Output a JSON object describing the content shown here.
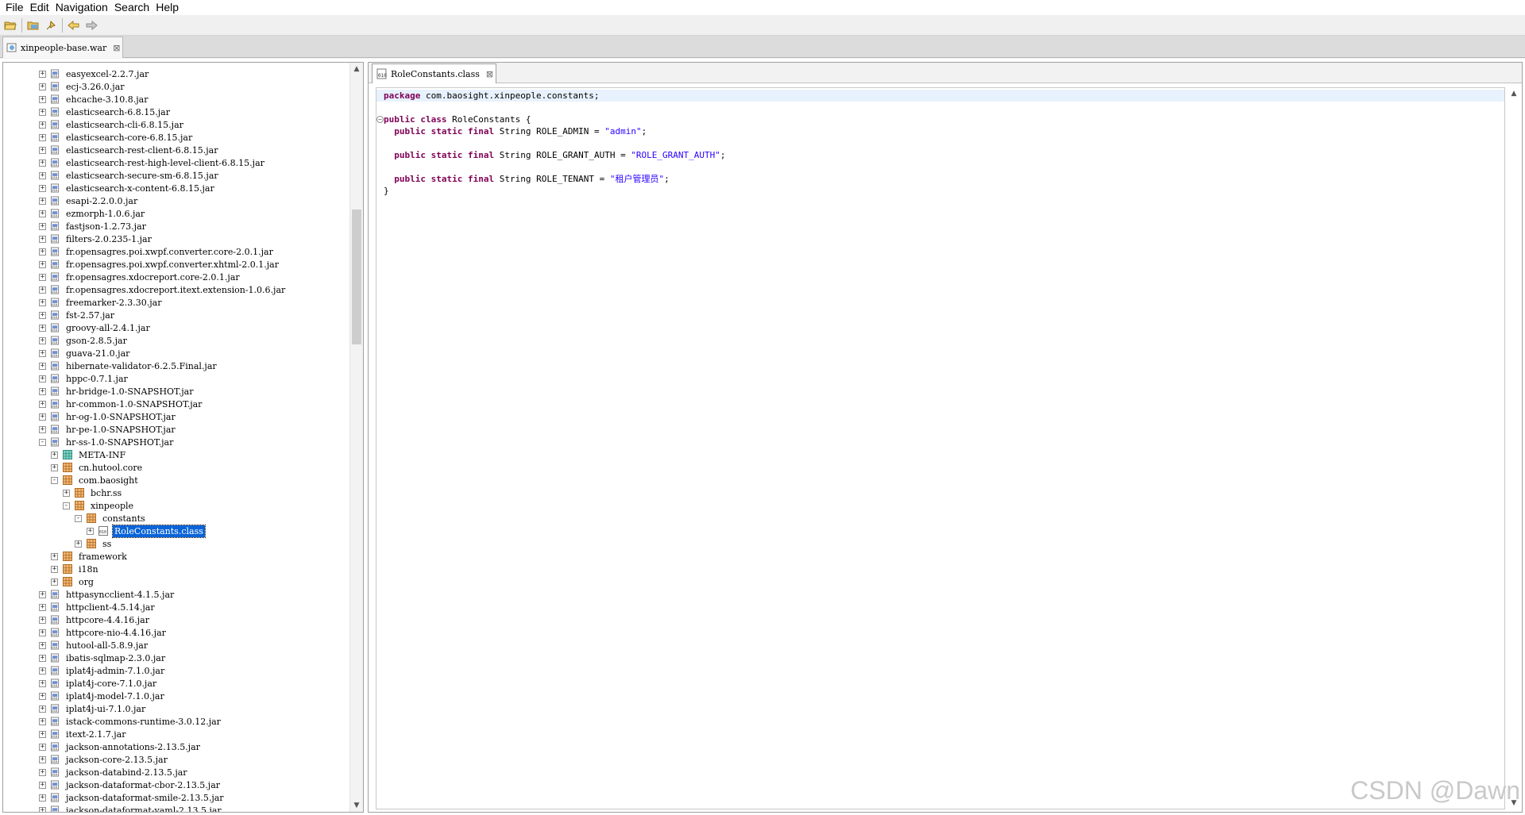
{
  "menu": [
    "File",
    "Edit",
    "Navigation",
    "Search",
    "Help"
  ],
  "toolbar": {
    "icons": [
      "open-file-icon",
      "open-folder-icon",
      "pin-icon",
      "back-arrow-icon",
      "forward-arrow-icon"
    ]
  },
  "outer_tab": {
    "label": "xinpeople-base.war",
    "close": "⊠"
  },
  "editor_tab": {
    "label": "RoleConstants.class",
    "close": "⊠"
  },
  "tree": [
    {
      "label": "easyexcel-2.2.7.jar",
      "level": 0,
      "type": "jar",
      "exp": "+"
    },
    {
      "label": "ecj-3.26.0.jar",
      "level": 0,
      "type": "jar",
      "exp": "+"
    },
    {
      "label": "ehcache-3.10.8.jar",
      "level": 0,
      "type": "jar",
      "exp": "+"
    },
    {
      "label": "elasticsearch-6.8.15.jar",
      "level": 0,
      "type": "jar",
      "exp": "+"
    },
    {
      "label": "elasticsearch-cli-6.8.15.jar",
      "level": 0,
      "type": "jar",
      "exp": "+"
    },
    {
      "label": "elasticsearch-core-6.8.15.jar",
      "level": 0,
      "type": "jar",
      "exp": "+"
    },
    {
      "label": "elasticsearch-rest-client-6.8.15.jar",
      "level": 0,
      "type": "jar",
      "exp": "+"
    },
    {
      "label": "elasticsearch-rest-high-level-client-6.8.15.jar",
      "level": 0,
      "type": "jar",
      "exp": "+"
    },
    {
      "label": "elasticsearch-secure-sm-6.8.15.jar",
      "level": 0,
      "type": "jar",
      "exp": "+"
    },
    {
      "label": "elasticsearch-x-content-6.8.15.jar",
      "level": 0,
      "type": "jar",
      "exp": "+"
    },
    {
      "label": "esapi-2.2.0.0.jar",
      "level": 0,
      "type": "jar",
      "exp": "+"
    },
    {
      "label": "ezmorph-1.0.6.jar",
      "level": 0,
      "type": "jar",
      "exp": "+"
    },
    {
      "label": "fastjson-1.2.73.jar",
      "level": 0,
      "type": "jar",
      "exp": "+"
    },
    {
      "label": "filters-2.0.235-1.jar",
      "level": 0,
      "type": "jar",
      "exp": "+"
    },
    {
      "label": "fr.opensagres.poi.xwpf.converter.core-2.0.1.jar",
      "level": 0,
      "type": "jar",
      "exp": "+"
    },
    {
      "label": "fr.opensagres.poi.xwpf.converter.xhtml-2.0.1.jar",
      "level": 0,
      "type": "jar",
      "exp": "+"
    },
    {
      "label": "fr.opensagres.xdocreport.core-2.0.1.jar",
      "level": 0,
      "type": "jar",
      "exp": "+"
    },
    {
      "label": "fr.opensagres.xdocreport.itext.extension-1.0.6.jar",
      "level": 0,
      "type": "jar",
      "exp": "+"
    },
    {
      "label": "freemarker-2.3.30.jar",
      "level": 0,
      "type": "jar",
      "exp": "+"
    },
    {
      "label": "fst-2.57.jar",
      "level": 0,
      "type": "jar",
      "exp": "+"
    },
    {
      "label": "groovy-all-2.4.1.jar",
      "level": 0,
      "type": "jar",
      "exp": "+"
    },
    {
      "label": "gson-2.8.5.jar",
      "level": 0,
      "type": "jar",
      "exp": "+"
    },
    {
      "label": "guava-21.0.jar",
      "level": 0,
      "type": "jar",
      "exp": "+"
    },
    {
      "label": "hibernate-validator-6.2.5.Final.jar",
      "level": 0,
      "type": "jar",
      "exp": "+"
    },
    {
      "label": "hppc-0.7.1.jar",
      "level": 0,
      "type": "jar",
      "exp": "+"
    },
    {
      "label": "hr-bridge-1.0-SNAPSHOT.jar",
      "level": 0,
      "type": "jar",
      "exp": "+"
    },
    {
      "label": "hr-common-1.0-SNAPSHOT.jar",
      "level": 0,
      "type": "jar",
      "exp": "+"
    },
    {
      "label": "hr-og-1.0-SNAPSHOT.jar",
      "level": 0,
      "type": "jar",
      "exp": "+"
    },
    {
      "label": "hr-pe-1.0-SNAPSHOT.jar",
      "level": 0,
      "type": "jar",
      "exp": "+"
    },
    {
      "label": "hr-ss-1.0-SNAPSHOT.jar",
      "level": 0,
      "type": "jar",
      "exp": "-"
    },
    {
      "label": "META-INF",
      "level": 1,
      "type": "folder",
      "exp": "+"
    },
    {
      "label": "cn.hutool.core",
      "level": 1,
      "type": "pkg",
      "exp": "+"
    },
    {
      "label": "com.baosight",
      "level": 1,
      "type": "pkg",
      "exp": "-"
    },
    {
      "label": "bchr.ss",
      "level": 2,
      "type": "pkg",
      "exp": "+"
    },
    {
      "label": "xinpeople",
      "level": 2,
      "type": "pkg",
      "exp": "-"
    },
    {
      "label": "constants",
      "level": 3,
      "type": "pkg",
      "exp": "-"
    },
    {
      "label": "RoleConstants.class",
      "level": 4,
      "type": "class",
      "exp": "+",
      "selected": true
    },
    {
      "label": "ss",
      "level": 3,
      "type": "pkg",
      "exp": "+"
    },
    {
      "label": "framework",
      "level": 1,
      "type": "pkg",
      "exp": "+"
    },
    {
      "label": "i18n",
      "level": 1,
      "type": "pkg",
      "exp": "+"
    },
    {
      "label": "org",
      "level": 1,
      "type": "pkg",
      "exp": "+"
    },
    {
      "label": "httpasyncclient-4.1.5.jar",
      "level": 0,
      "type": "jar",
      "exp": "+"
    },
    {
      "label": "httpclient-4.5.14.jar",
      "level": 0,
      "type": "jar",
      "exp": "+"
    },
    {
      "label": "httpcore-4.4.16.jar",
      "level": 0,
      "type": "jar",
      "exp": "+"
    },
    {
      "label": "httpcore-nio-4.4.16.jar",
      "level": 0,
      "type": "jar",
      "exp": "+"
    },
    {
      "label": "hutool-all-5.8.9.jar",
      "level": 0,
      "type": "jar",
      "exp": "+"
    },
    {
      "label": "ibatis-sqlmap-2.3.0.jar",
      "level": 0,
      "type": "jar",
      "exp": "+"
    },
    {
      "label": "iplat4j-admin-7.1.0.jar",
      "level": 0,
      "type": "jar",
      "exp": "+"
    },
    {
      "label": "iplat4j-core-7.1.0.jar",
      "level": 0,
      "type": "jar",
      "exp": "+"
    },
    {
      "label": "iplat4j-model-7.1.0.jar",
      "level": 0,
      "type": "jar",
      "exp": "+"
    },
    {
      "label": "iplat4j-ui-7.1.0.jar",
      "level": 0,
      "type": "jar",
      "exp": "+"
    },
    {
      "label": "istack-commons-runtime-3.0.12.jar",
      "level": 0,
      "type": "jar",
      "exp": "+"
    },
    {
      "label": "itext-2.1.7.jar",
      "level": 0,
      "type": "jar",
      "exp": "+"
    },
    {
      "label": "jackson-annotations-2.13.5.jar",
      "level": 0,
      "type": "jar",
      "exp": "+"
    },
    {
      "label": "jackson-core-2.13.5.jar",
      "level": 0,
      "type": "jar",
      "exp": "+"
    },
    {
      "label": "jackson-databind-2.13.5.jar",
      "level": 0,
      "type": "jar",
      "exp": "+"
    },
    {
      "label": "jackson-dataformat-cbor-2.13.5.jar",
      "level": 0,
      "type": "jar",
      "exp": "+"
    },
    {
      "label": "jackson-dataformat-smile-2.13.5.jar",
      "level": 0,
      "type": "jar",
      "exp": "+"
    },
    {
      "label": "jackson-dataformat-yaml-2.13.5.jar",
      "level": 0,
      "type": "jar",
      "exp": "+"
    }
  ],
  "code": [
    {
      "segments": [
        {
          "t": "package",
          "c": "kw"
        },
        {
          "t": " com.baosight.xinpeople.constants;",
          "c": ""
        }
      ],
      "current": true
    },
    {
      "segments": [],
      "current": false
    },
    {
      "segments": [
        {
          "t": "public",
          "c": "kw"
        },
        {
          "t": " ",
          "c": ""
        },
        {
          "t": "class",
          "c": "kw"
        },
        {
          "t": " RoleConstants {",
          "c": ""
        }
      ],
      "fold": "−"
    },
    {
      "segments": [
        {
          "t": "  ",
          "c": ""
        },
        {
          "t": "public",
          "c": "kw"
        },
        {
          "t": " ",
          "c": ""
        },
        {
          "t": "static",
          "c": "kw"
        },
        {
          "t": " ",
          "c": ""
        },
        {
          "t": "final",
          "c": "kw"
        },
        {
          "t": " String ROLE_ADMIN = ",
          "c": ""
        },
        {
          "t": "\"admin\"",
          "c": "str"
        },
        {
          "t": ";",
          "c": ""
        }
      ]
    },
    {
      "segments": []
    },
    {
      "segments": [
        {
          "t": "  ",
          "c": ""
        },
        {
          "t": "public",
          "c": "kw"
        },
        {
          "t": " ",
          "c": ""
        },
        {
          "t": "static",
          "c": "kw"
        },
        {
          "t": " ",
          "c": ""
        },
        {
          "t": "final",
          "c": "kw"
        },
        {
          "t": " String ROLE_GRANT_AUTH = ",
          "c": ""
        },
        {
          "t": "\"ROLE_GRANT_AUTH\"",
          "c": "str"
        },
        {
          "t": ";",
          "c": ""
        }
      ]
    },
    {
      "segments": []
    },
    {
      "segments": [
        {
          "t": "  ",
          "c": ""
        },
        {
          "t": "public",
          "c": "kw"
        },
        {
          "t": " ",
          "c": ""
        },
        {
          "t": "static",
          "c": "kw"
        },
        {
          "t": " ",
          "c": ""
        },
        {
          "t": "final",
          "c": "kw"
        },
        {
          "t": " String ROLE_TENANT = ",
          "c": ""
        },
        {
          "t": "\"租户管理员\"",
          "c": "str"
        },
        {
          "t": ";",
          "c": ""
        }
      ]
    },
    {
      "segments": [
        {
          "t": "}",
          "c": ""
        }
      ]
    }
  ],
  "watermark": "CSDN @Dawn",
  "colors": {
    "keyword": "#7f0055",
    "string": "#2a00ff",
    "selection": "#0a64d8",
    "current_line": "#e8f2fe"
  }
}
